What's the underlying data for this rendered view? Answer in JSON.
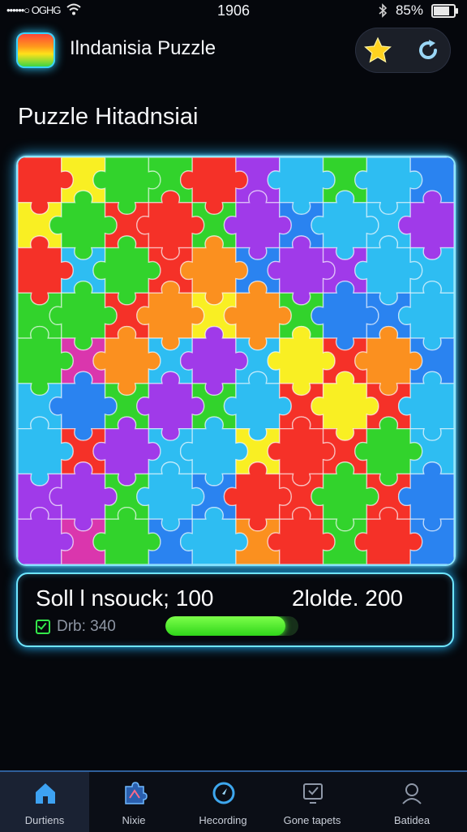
{
  "status_bar": {
    "carrier": "••••••○ OGHG",
    "time": "1906",
    "battery_text": "85%",
    "battery_level": 0.85
  },
  "header": {
    "title": "Ilndanisia Puzzle",
    "icons": [
      "app-logo",
      "star-icon",
      "refresh-icon"
    ]
  },
  "page": {
    "section_title": "Puzzle Hitadnsiai"
  },
  "board": {
    "cols": 10,
    "rows": 9,
    "palette": {
      "R": "#f5251b",
      "O": "#fb8a12",
      "Y": "#f9ef16",
      "G": "#26d11f",
      "C": "#21b9f2",
      "B": "#1d7cf0",
      "P": "#9b2ee8",
      "M": "#d82aa8"
    },
    "grid": [
      [
        "R",
        "Y",
        "G",
        "G",
        "R",
        "P",
        "C",
        "G",
        "C",
        "B"
      ],
      [
        "Y",
        "G",
        "R",
        "R",
        "G",
        "P",
        "B",
        "C",
        "C",
        "P"
      ],
      [
        "R",
        "C",
        "G",
        "R",
        "O",
        "B",
        "P",
        "P",
        "C",
        "C"
      ],
      [
        "G",
        "G",
        "R",
        "O",
        "Y",
        "O",
        "G",
        "B",
        "B",
        "C"
      ],
      [
        "G",
        "M",
        "O",
        "C",
        "P",
        "C",
        "Y",
        "R",
        "O",
        "B"
      ],
      [
        "C",
        "B",
        "G",
        "P",
        "G",
        "C",
        "R",
        "Y",
        "R",
        "C"
      ],
      [
        "C",
        "R",
        "P",
        "C",
        "C",
        "Y",
        "R",
        "R",
        "G",
        "C"
      ],
      [
        "P",
        "P",
        "G",
        "C",
        "B",
        "R",
        "R",
        "G",
        "R",
        "B"
      ],
      [
        "P",
        "M",
        "G",
        "B",
        "C",
        "O",
        "R",
        "G",
        "R",
        "B"
      ]
    ]
  },
  "score_panel": {
    "score_text": "Soll l nsouck; 100",
    "goal_text": "2lolde. 200",
    "time_text": "Drb: 340",
    "progress": 0.9
  },
  "nav": {
    "items": [
      {
        "label": "Durtiens",
        "icon": "home-icon"
      },
      {
        "label": "Nixie",
        "icon": "puzzle-icon"
      },
      {
        "label": "Hecording",
        "icon": "compass-icon"
      },
      {
        "label": "Gone tapets",
        "icon": "screen-icon"
      },
      {
        "label": "Batidea",
        "icon": "profile-icon"
      }
    ]
  }
}
